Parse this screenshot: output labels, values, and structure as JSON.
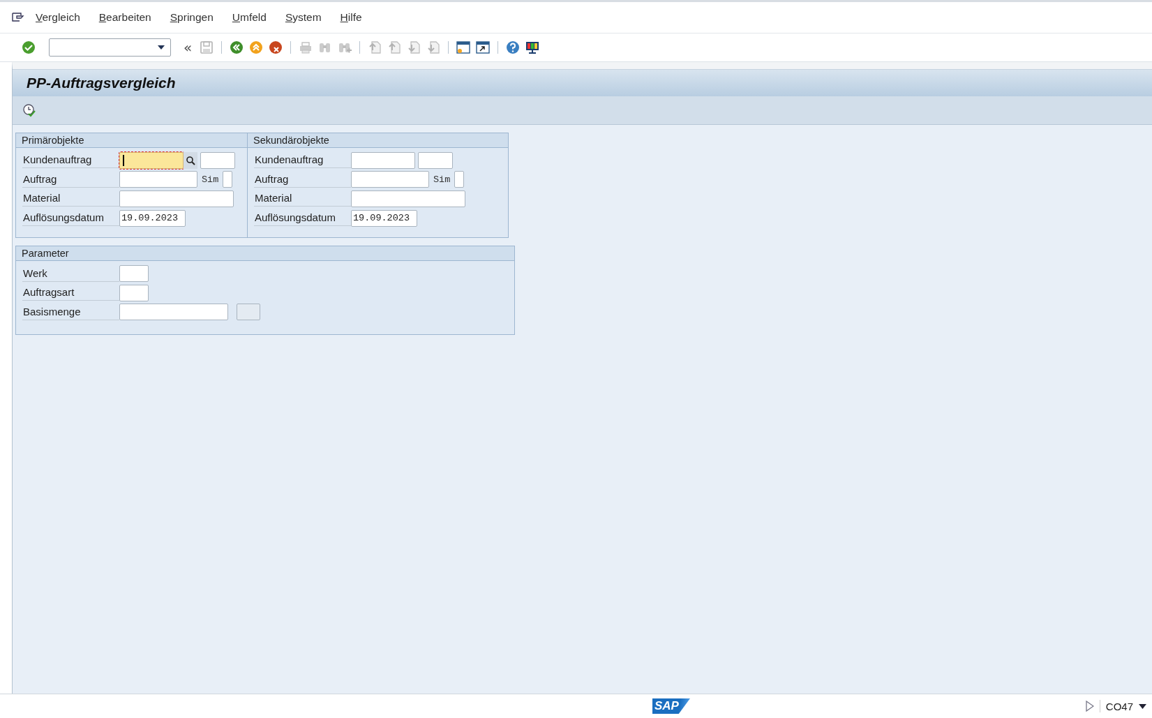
{
  "menu": [
    {
      "label": "Vergleich"
    },
    {
      "label": "Bearbeiten"
    },
    {
      "label": "Springen"
    },
    {
      "label": "Umfeld"
    },
    {
      "label": "System"
    },
    {
      "label": "Hilfe"
    }
  ],
  "toolbar": [
    {
      "kind": "enter",
      "disabled": false
    },
    {
      "kind": "command-field"
    },
    {
      "kind": "collapse",
      "disabled": false
    },
    {
      "kind": "save",
      "disabled": true
    },
    {
      "kind": "sep"
    },
    {
      "kind": "back",
      "disabled": false
    },
    {
      "kind": "exit",
      "disabled": false
    },
    {
      "kind": "cancel",
      "disabled": false
    },
    {
      "kind": "sep"
    },
    {
      "kind": "print",
      "disabled": true
    },
    {
      "kind": "find",
      "disabled": true
    },
    {
      "kind": "find-next",
      "disabled": true
    },
    {
      "kind": "sep"
    },
    {
      "kind": "first-page",
      "disabled": true
    },
    {
      "kind": "prev-page",
      "disabled": true
    },
    {
      "kind": "next-page",
      "disabled": true
    },
    {
      "kind": "last-page",
      "disabled": true
    },
    {
      "kind": "sep"
    },
    {
      "kind": "new-session",
      "disabled": false
    },
    {
      "kind": "shortcut",
      "disabled": false
    },
    {
      "kind": "sep"
    },
    {
      "kind": "help",
      "disabled": false
    },
    {
      "kind": "layout",
      "disabled": false
    }
  ],
  "collapse_glyph": "«",
  "screen_title": "PP-Auftragsvergleich",
  "top_groups": [
    {
      "title": "Primärobjekte",
      "rows": [
        {
          "label": "Kundenauftrag",
          "fields": [
            {
              "kind": "sales-order",
              "focused": true
            },
            {
              "kind": "item",
              "focused": false
            }
          ]
        },
        {
          "label": "Auftrag",
          "fields": [
            {
              "kind": "order",
              "focused": false
            },
            {
              "kind": "text",
              "text": "Sim"
            },
            {
              "kind": "flag",
              "focused": false
            }
          ]
        },
        {
          "label": "Material",
          "fields": [
            {
              "kind": "material",
              "focused": false
            }
          ]
        },
        {
          "label": "Auflösungsdatum",
          "fields": [
            {
              "kind": "date",
              "focused": false,
              "value": "19.09.2023"
            }
          ]
        }
      ]
    },
    {
      "title": "Sekundärobjekte",
      "rows": [
        {
          "label": "Kundenauftrag",
          "fields": [
            {
              "kind": "sales-order",
              "focused": false
            },
            {
              "kind": "item",
              "focused": false
            }
          ]
        },
        {
          "label": "Auftrag",
          "fields": [
            {
              "kind": "order",
              "focused": false
            },
            {
              "kind": "text",
              "text": "Sim"
            },
            {
              "kind": "flag",
              "focused": false
            }
          ]
        },
        {
          "label": "Material",
          "fields": [
            {
              "kind": "material",
              "focused": false
            }
          ]
        },
        {
          "label": "Auflösungsdatum",
          "fields": [
            {
              "kind": "date",
              "focused": false,
              "value": "19.09.2023"
            }
          ]
        }
      ]
    }
  ],
  "parameter_group": {
    "title": "Parameter",
    "rows": [
      {
        "label": "Werk",
        "fields": [
          {
            "kind": "plant",
            "focused": false
          }
        ]
      },
      {
        "label": "Auftragsart",
        "fields": [
          {
            "kind": "order-type",
            "focused": false
          }
        ]
      },
      {
        "label": "Basismenge",
        "fields": [
          {
            "kind": "quantity",
            "focused": false
          },
          {
            "kind": "unit",
            "focused": false
          }
        ]
      }
    ]
  },
  "status_bar": {
    "logo": "SAP",
    "transaction": "CO47"
  }
}
